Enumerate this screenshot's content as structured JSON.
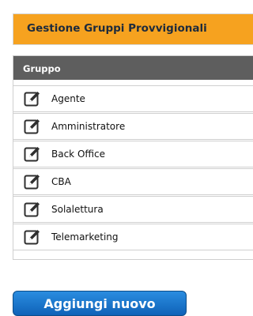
{
  "header": {
    "title": "Gestione Gruppi Provvigionali"
  },
  "table": {
    "column_header": "Gruppo",
    "rows": [
      {
        "label": "Agente",
        "icon": "edit-icon"
      },
      {
        "label": "Amministratore",
        "icon": "edit-icon"
      },
      {
        "label": "Back Office",
        "icon": "edit-icon"
      },
      {
        "label": "CBA",
        "icon": "edit-icon"
      },
      {
        "label": "Solalettura",
        "icon": "edit-icon"
      },
      {
        "label": "Telemarketing",
        "icon": "edit-icon"
      }
    ]
  },
  "actions": {
    "add_label": "Aggiungi nuovo"
  },
  "colors": {
    "header_bg": "#f6a21f",
    "table_head_bg": "#5e5e5e",
    "button_bg": "#1776cc"
  }
}
